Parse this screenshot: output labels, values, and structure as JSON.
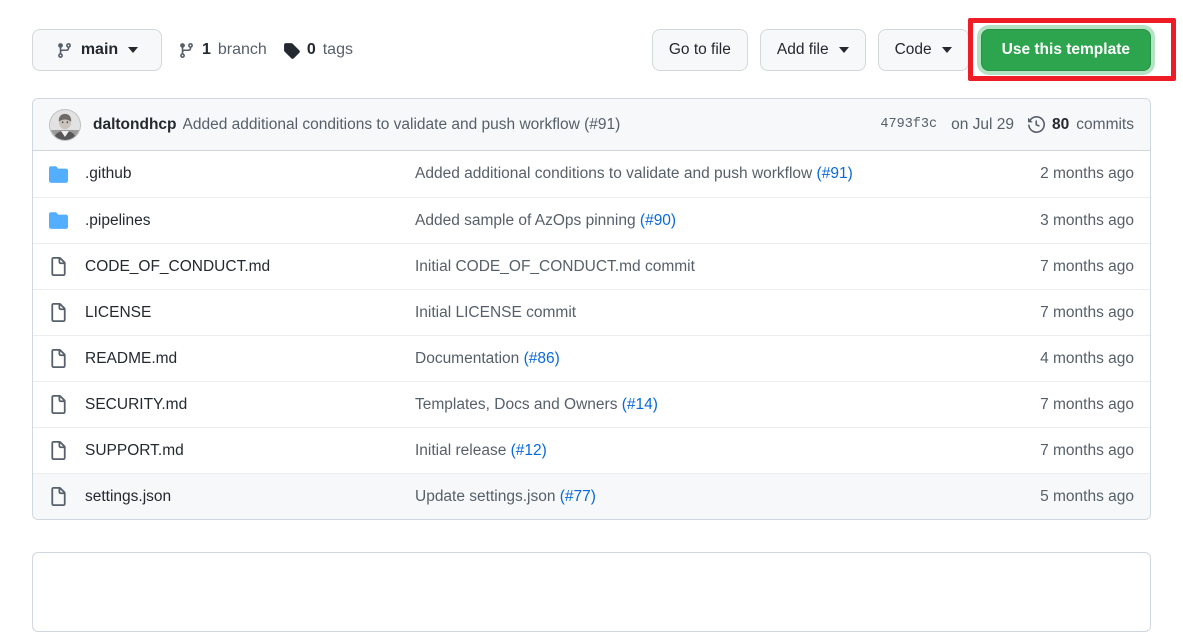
{
  "toolbar": {
    "branch_button": {
      "icon": "git-branch-icon",
      "label": "main",
      "caret": "chevron-down-icon"
    },
    "branch_count": {
      "icon": "git-branch-icon",
      "count": "1",
      "label": "branch"
    },
    "tag_count": {
      "icon": "tag-icon",
      "count": "0",
      "label": "tags"
    },
    "go_to_file_label": "Go to file",
    "add_file_label": "Add file",
    "code_label": "Code",
    "use_template_label": "Use this template"
  },
  "annotation": {
    "target": "use-this-template-button",
    "color": "#ee1c25"
  },
  "commit_bar": {
    "author": "daltondhcp",
    "message": "Added additional conditions to validate and push workflow (#91)",
    "sha": "4793f3c",
    "date": "on Jul 29",
    "commits_icon": "history-icon",
    "commits_count": "80",
    "commits_label": "commits"
  },
  "file_table": {
    "rows": [
      {
        "type": "folder",
        "icon": "folder-icon",
        "name": ".github",
        "message": "Added additional conditions to validate and push workflow ",
        "pr": "(#91)",
        "time": "2 months ago"
      },
      {
        "type": "folder",
        "icon": "folder-icon",
        "name": ".pipelines",
        "message": "Added sample of AzOps pinning ",
        "pr": "(#90)",
        "time": "3 months ago"
      },
      {
        "type": "file",
        "icon": "file-icon",
        "name": "CODE_OF_CONDUCT.md",
        "message": "Initial CODE_OF_CONDUCT.md commit",
        "pr": "",
        "time": "7 months ago"
      },
      {
        "type": "file",
        "icon": "file-icon",
        "name": "LICENSE",
        "message": "Initial LICENSE commit",
        "pr": "",
        "time": "7 months ago"
      },
      {
        "type": "file",
        "icon": "file-icon",
        "name": "README.md",
        "message": "Documentation ",
        "pr": "(#86)",
        "time": "4 months ago"
      },
      {
        "type": "file",
        "icon": "file-icon",
        "name": "SECURITY.md",
        "message": "Templates, Docs and Owners ",
        "pr": "(#14)",
        "time": "7 months ago"
      },
      {
        "type": "file",
        "icon": "file-icon",
        "name": "SUPPORT.md",
        "message": "Initial release ",
        "pr": "(#12)",
        "time": "7 months ago"
      },
      {
        "type": "file",
        "icon": "file-icon",
        "name": "settings.json",
        "message": "Update settings.json ",
        "pr": "(#77)",
        "time": "5 months ago"
      }
    ]
  },
  "colors": {
    "accent_link": "#0969da",
    "folder_icon": "#54aeff",
    "green_button": "#2da44e",
    "annotation_red": "#ee1c25",
    "muted_text": "#57606a",
    "border": "#d0d7de"
  }
}
